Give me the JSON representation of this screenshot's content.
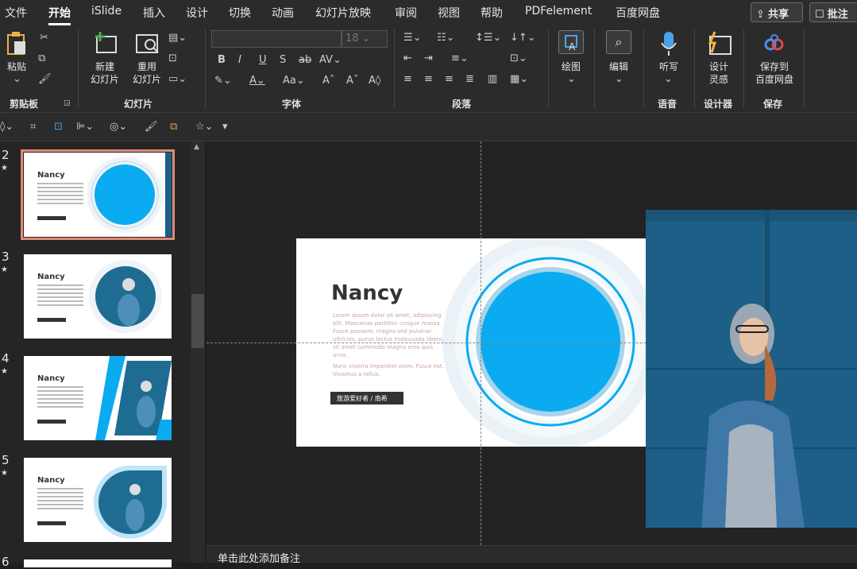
{
  "menu": {
    "tabs": [
      "文件",
      "开始",
      "iSlide",
      "插入",
      "设计",
      "切换",
      "动画",
      "幻灯片放映",
      "审阅",
      "视图",
      "帮助",
      "PDFelement",
      "百度网盘"
    ],
    "share": "共享",
    "comment": "批注"
  },
  "ribbon": {
    "clipboard": {
      "paste": "粘贴",
      "group": "剪贴板"
    },
    "slides": {
      "new_slide_1": "新建",
      "new_slide_2": "幻灯片",
      "reuse_1": "重用",
      "reuse_2": "幻灯片",
      "group": "幻灯片"
    },
    "font": {
      "font_name": "",
      "font_size": "18",
      "group": "字体"
    },
    "paragraph": {
      "group": "段落"
    },
    "drawing": {
      "label": "绘图"
    },
    "editing": {
      "label": "编辑"
    },
    "voice": {
      "dictate": "听写",
      "group": "语音"
    },
    "designer": {
      "label_1": "设计",
      "label_2": "灵感",
      "group": "设计器"
    },
    "save": {
      "label_1": "保存到",
      "label_2": "百度网盘",
      "group": "保存"
    }
  },
  "thumbnails": [
    {
      "number": "2",
      "title": "Nancy",
      "selected": true
    },
    {
      "number": "3",
      "title": "Nancy",
      "selected": false
    },
    {
      "number": "4",
      "title": "Nancy",
      "selected": false
    },
    {
      "number": "5",
      "title": "Nancy",
      "selected": false
    },
    {
      "number": "6",
      "title": "",
      "selected": false
    }
  ],
  "slide": {
    "title": "Nancy",
    "body1": "Lorem ipsum dolor sit amet, adipiscing elit. Maecenas porttitor congue massa. Fusce posuere, magna sed pulvinar ultricies, purus lectus malesuada libero, sit amet commodo magna eros quis urna.",
    "body2": "Nunc viverra imperdiet enim. Fusce est. Vivamus a tellus.",
    "tag": "旅游爱好者 / 南希",
    "accent": "#0aabf0"
  },
  "notes": {
    "placeholder": "单击此处添加备注"
  }
}
